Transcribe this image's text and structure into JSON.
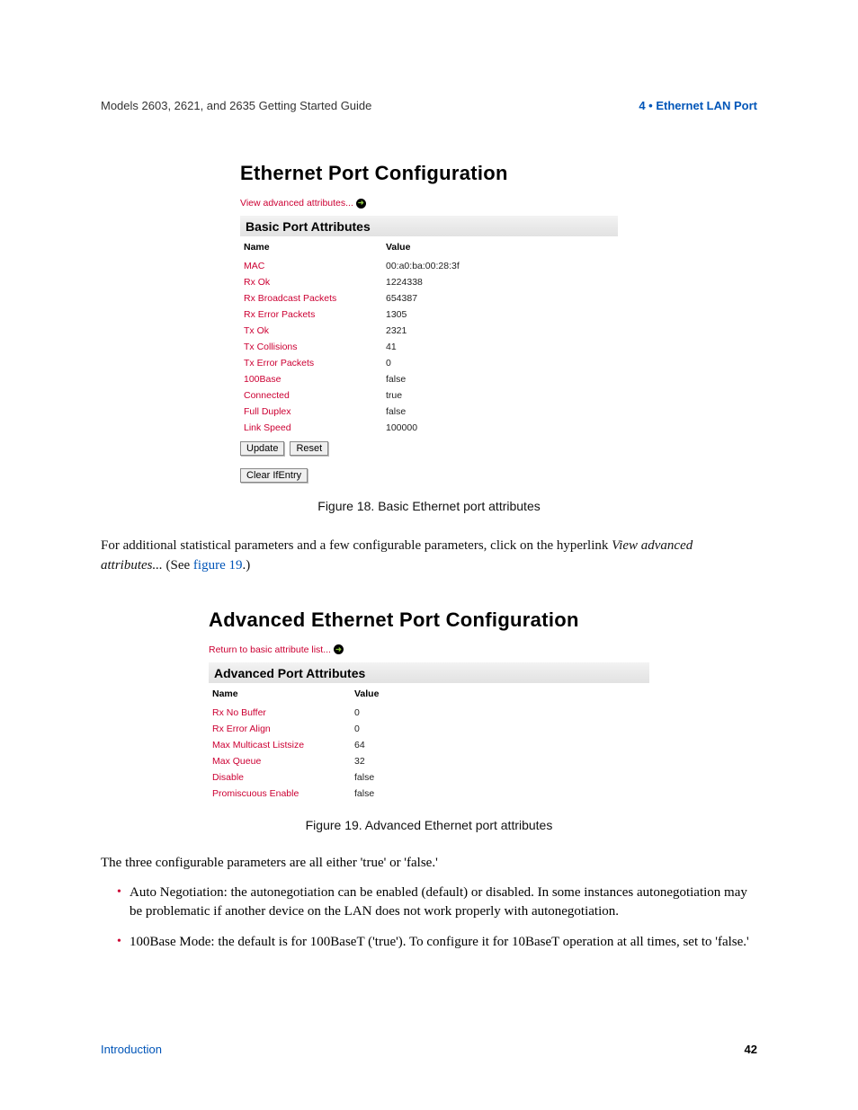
{
  "header": {
    "left": "Models 2603, 2621, and 2635 Getting Started Guide",
    "right": "4 • Ethernet LAN Port"
  },
  "fig1": {
    "title": "Ethernet Port Configuration",
    "advlink": "View advanced attributes...",
    "sectionbar": "Basic Port Attributes",
    "name_header": "Name",
    "value_header": "Value",
    "rows": [
      {
        "n": "MAC",
        "v": "00:a0:ba:00:28:3f"
      },
      {
        "n": "Rx Ok",
        "v": "1224338"
      },
      {
        "n": "Rx Broadcast Packets",
        "v": "654387"
      },
      {
        "n": "Rx Error Packets",
        "v": "1305"
      },
      {
        "n": "Tx Ok",
        "v": "2321"
      },
      {
        "n": "Tx Collisions",
        "v": "41"
      },
      {
        "n": "Tx Error Packets",
        "v": "0"
      },
      {
        "n": "100Base",
        "v": "false"
      },
      {
        "n": "Connected",
        "v": "true"
      },
      {
        "n": "Full Duplex",
        "v": "false"
      },
      {
        "n": "Link Speed",
        "v": "100000"
      }
    ],
    "update_btn": "Update",
    "reset_btn": "Reset",
    "clear_btn": "Clear IfEntry",
    "caption": "Figure 18. Basic Ethernet port attributes"
  },
  "para1": {
    "lead": "For additional statistical parameters and a few configurable parameters, click on the hyperlink ",
    "linktext": "View advanced attributes...",
    "tail1": " (See ",
    "figref": "figure 19",
    "tail2": ".)"
  },
  "fig2": {
    "title": "Advanced Ethernet Port Configuration",
    "advlink": "Return to basic attribute list...",
    "sectionbar": "Advanced Port Attributes",
    "name_header": "Name",
    "value_header": "Value",
    "rows": [
      {
        "n": "Rx No Buffer",
        "v": "0"
      },
      {
        "n": "Rx Error Align",
        "v": "0"
      },
      {
        "n": "Max Multicast Listsize",
        "v": "64"
      },
      {
        "n": "Max Queue",
        "v": "32"
      },
      {
        "n": "Disable",
        "v": "false"
      },
      {
        "n": "Promiscuous Enable",
        "v": "false"
      }
    ],
    "caption": "Figure 19. Advanced Ethernet port attributes"
  },
  "para2": "The three configurable parameters are all either 'true' or 'false.'",
  "bullets": [
    "Auto Negotiation: the autonegotiation can be enabled (default) or disabled. In some instances autonegotiation may be problematic if another device on the LAN does not work properly with autonegotiation.",
    "100Base Mode: the default is for 100BaseT ('true'). To configure it for 10BaseT operation at all times, set to 'false.'"
  ],
  "footer": {
    "left": "Introduction",
    "right": "42"
  }
}
